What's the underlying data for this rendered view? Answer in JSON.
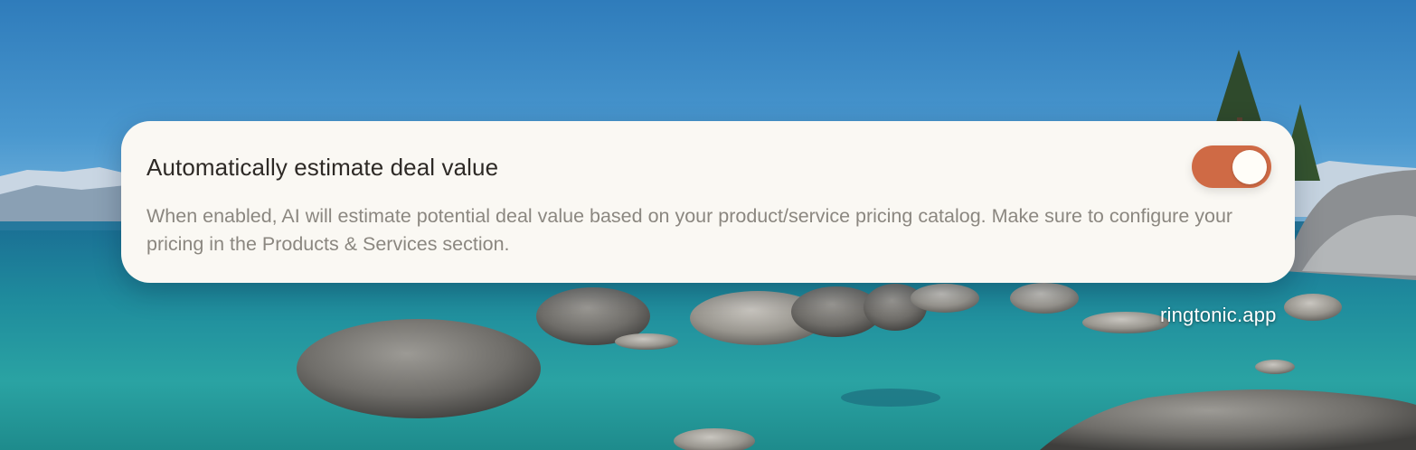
{
  "setting": {
    "title": "Automatically estimate deal value",
    "description": "When enabled, AI will estimate potential deal value based on your product/service pricing catalog. Make sure to configure your pricing in the Products & Services section.",
    "toggle_on": true,
    "toggle_color": "#cf6a45"
  },
  "watermark": "ringtonic.app",
  "colors": {
    "card_background": "#faf8f3",
    "title_text": "#2e2a26",
    "description_text": "#8b8780"
  }
}
